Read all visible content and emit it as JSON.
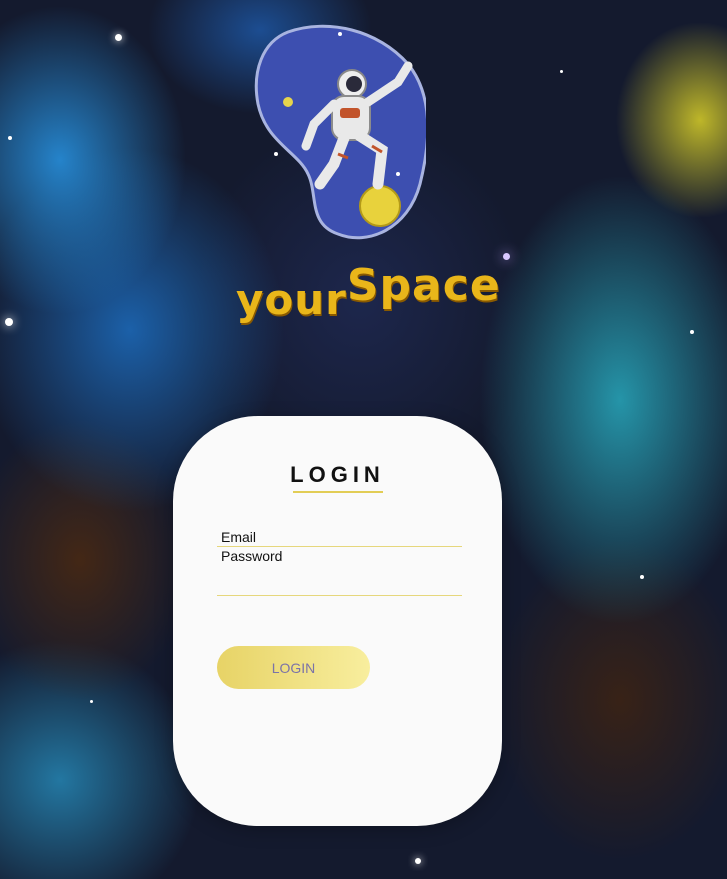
{
  "brand": {
    "word1": "your",
    "word2": "Space"
  },
  "login": {
    "title": "LOGIN",
    "email_placeholder": "Email",
    "password_label": "Password",
    "password_placeholder": "",
    "button_label": "LOGIN"
  },
  "colors": {
    "accent_yellow": "#e2cd55",
    "card_bg": "#fafafa",
    "button_text": "#7b73a8",
    "brand_gold": "#e9b61a"
  }
}
